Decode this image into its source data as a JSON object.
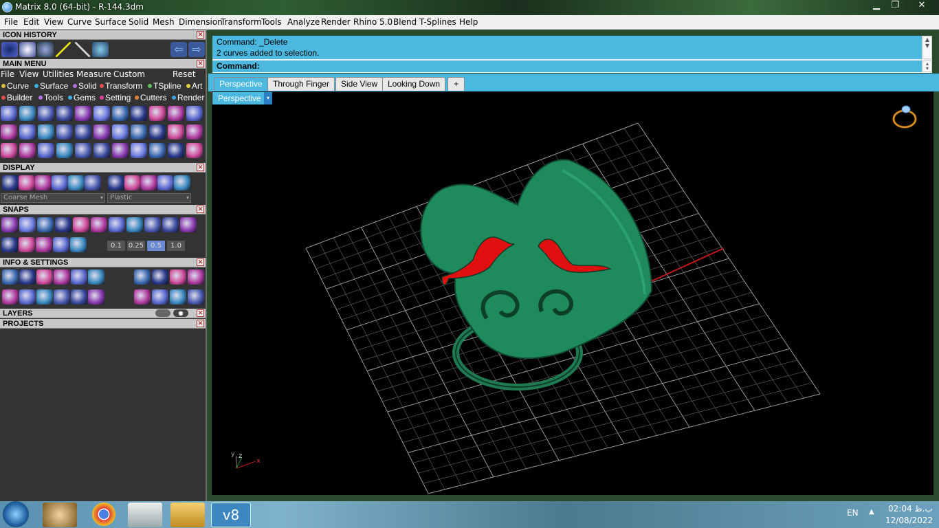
{
  "titlebar": {
    "title": "Matrix 8.0 (64-bit) - R-144.3dm",
    "minimize": "▁",
    "maximize": "❐",
    "close": "✕"
  },
  "menubar": [
    "File",
    "Edit",
    "View",
    "Curve",
    "Surface",
    "Solid",
    "Mesh",
    "Dimension",
    "Transform",
    "Tools",
    "Analyze",
    "Render",
    "Rhino 5.0",
    "Blend",
    "T-Splines",
    "Help"
  ],
  "panels": {
    "icon_history": "ICON HISTORY",
    "main_menu": "MAIN MENU",
    "display": "DISPLAY",
    "snaps": "SNAPS",
    "info_settings": "INFO & SETTINGS",
    "layers": "LAYERS",
    "projects": "PROJECTS"
  },
  "main_menu_items": [
    "File",
    "View",
    "Utilities",
    "Measure",
    "Custom"
  ],
  "main_menu_reset": "Reset",
  "category_row1": [
    "Curve",
    "Surface",
    "Solid",
    "Transform",
    "TSpline",
    "Art"
  ],
  "category_row2": [
    "Builder",
    "Tools",
    "Gems",
    "Setting",
    "Cutters",
    "Render"
  ],
  "category_colors": {
    "Curve": "#e0c040",
    "Surface": "#40b0e0",
    "Solid": "#b070e0",
    "Transform": "#e05050",
    "TSpline": "#60c060",
    "Art": "#e0d040",
    "Builder": "#e05050",
    "Tools": "#b070e0",
    "Gems": "#40b0e0",
    "Setting": "#e040a0",
    "Cutters": "#e08030",
    "Render": "#40a0e0"
  },
  "display": {
    "mesh": "Coarse Mesh",
    "material": "Plastic"
  },
  "snaps_values": [
    "0.1",
    "0.25",
    "0.5",
    "1.0"
  ],
  "command": {
    "line1": "Command: _Delete",
    "line2": "2 curves added to selection.",
    "prompt": "Command:"
  },
  "viewport_tabs": [
    "Perspective",
    "Through Finger",
    "Side View",
    "Looking Down"
  ],
  "viewport_tab_add": "+",
  "viewport_label": "Perspective",
  "viewport_dd": "▾",
  "axes": {
    "x": "x",
    "y": "y",
    "z": "z"
  },
  "taskbar": {
    "lang": "EN",
    "time": "ب.ظ 02:04",
    "date": "12/08/2022",
    "matrix_label": "v8"
  }
}
